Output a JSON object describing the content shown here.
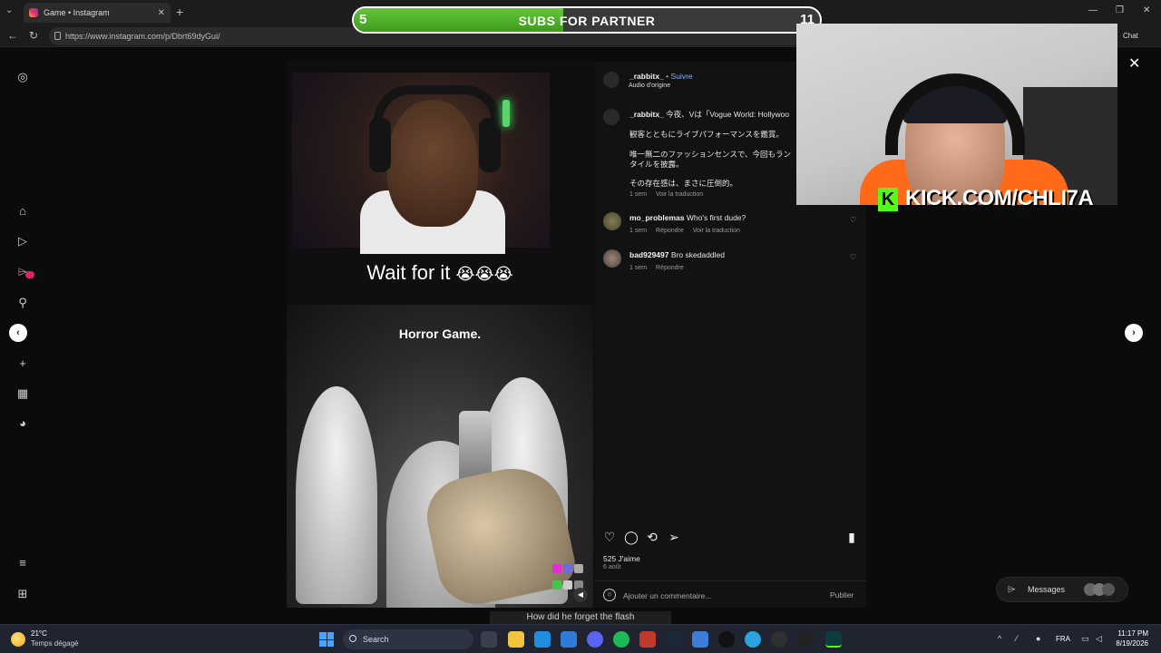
{
  "browser": {
    "tab_title": "Game • Instagram",
    "tab_close": "✕",
    "new_tab": "+",
    "url": "https://www.instagram.com/p/Dbrt69dyGui/",
    "chat_label": "Chat"
  },
  "overlay": {
    "left_count": "5",
    "label": "SUBS FOR PARTNER",
    "right_count": "11",
    "progress_fraction": 0.45,
    "accent": "#53c22b"
  },
  "post": {
    "video_caption": "Wait for it",
    "video_caption_emoji": "😭😭😭",
    "game_title": "Horror Game.",
    "subtitle": "How did he forget the flash",
    "author": "_rabbitx_",
    "follow_label": "Suivre",
    "audio": "Audio d'origine",
    "caption_user": "_rabbitx_",
    "caption_line1": "今夜、Vは「Vogue World: Hollywoo",
    "caption_line2": "観客とともにライブパフォーマンスを鑑賞。",
    "caption_line3": "唯一無二のファッションセンスで、今回もラン",
    "caption_line4": "タイルを披露。",
    "caption_line5": "その存在感は、まさに圧倒的。",
    "caption_time": "1 sem",
    "caption_translate": "Voir la traduction",
    "comments": [
      {
        "user": "mo_problemas",
        "text": "Who's first dude?",
        "time": "1 sem",
        "reply": "Répondre",
        "translate": "Voir la traduction"
      },
      {
        "user": "bad929497",
        "text": "Bro skedaddled",
        "time": "1 sem",
        "reply": "Répondre"
      }
    ],
    "likes": "525 J'aime",
    "date": "6 août",
    "comment_placeholder": "Ajouter un commentaire...",
    "publish_label": "Publier"
  },
  "stream": {
    "kick_logo": "K",
    "kick_url": "KICK.COM/CHLI7A",
    "brand_color": "#53fc18"
  },
  "messages": {
    "label": "Messages"
  },
  "taskbar": {
    "temperature": "21°C",
    "weather": "Temps dégagé",
    "search_label": "Search",
    "language": "FRA",
    "time": "11:17 PM",
    "date": "8/19/2026"
  }
}
